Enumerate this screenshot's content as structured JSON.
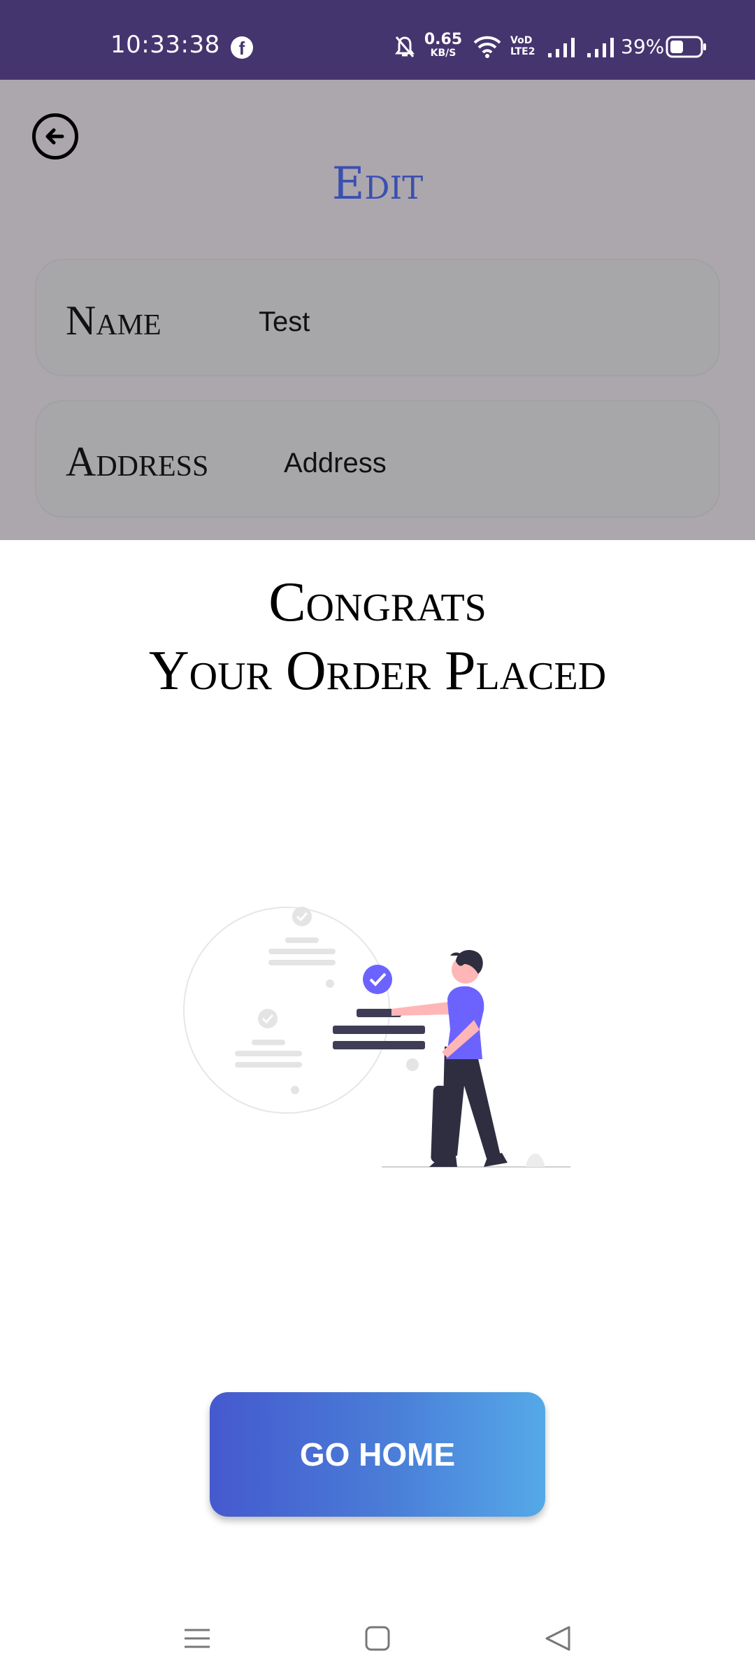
{
  "status_bar": {
    "time": "10:33:38",
    "facebook_glyph": "f",
    "net_speed_value": "0.65",
    "net_speed_unit": "KB/S",
    "volte_line1": "VoD",
    "volte_line2": "LTE2",
    "battery_percent": "39%",
    "icons": [
      "facebook-icon",
      "mute-icon",
      "wifi-icon",
      "signal-icon",
      "signal-icon",
      "battery-icon"
    ]
  },
  "edit_screen": {
    "title": "Edit",
    "back_icon": "arrow-left-circle-icon",
    "fields": {
      "name_label": "Name",
      "name_value": "Test",
      "address_label": "Address",
      "address_value": "Address"
    }
  },
  "order_sheet": {
    "title_line1": "Congrats",
    "title_line2": "Your Order Placed",
    "illustration": "order-confirmed-illustration",
    "button_label": "GO HOME"
  },
  "nav_bar": {
    "icons": [
      "menu-icon",
      "home-square-icon",
      "back-triangle-icon"
    ]
  },
  "colors": {
    "status_bar": "#45356f",
    "edit_title": "#3b4fb0",
    "button_gradient_start": "#4559ce",
    "button_gradient_end": "#55a9e8",
    "illustration_accent": "#6c63ff"
  }
}
